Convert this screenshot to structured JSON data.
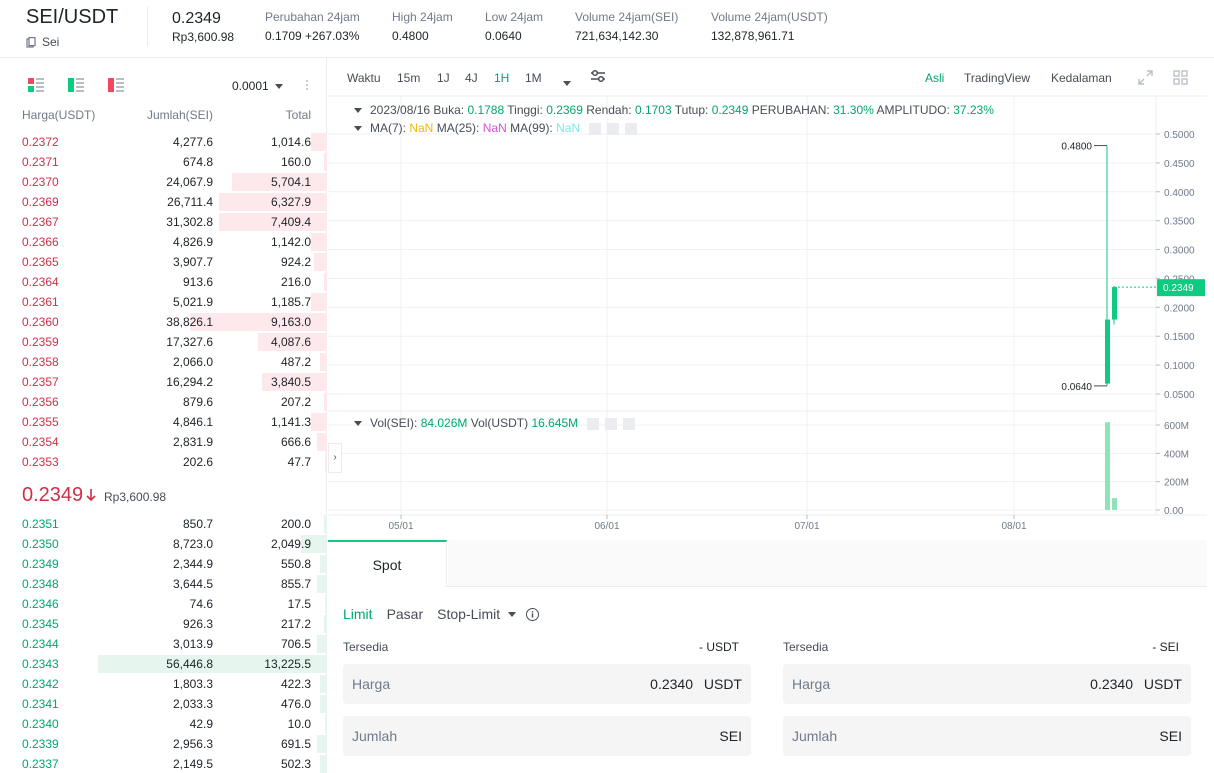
{
  "header": {
    "pair": "SEI/USDT",
    "coin": "Sei",
    "last_price": "0.2349",
    "last_price_local": "Rp3,600.98",
    "stats": [
      {
        "label": "Perubahan 24jam",
        "value": "0.1709 +267.03%",
        "color": "#0ecb81"
      },
      {
        "label": "High 24jam",
        "value": "0.4800"
      },
      {
        "label": "Low 24jam",
        "value": "0.0640"
      },
      {
        "label": "Volume 24jam(SEI)",
        "value": "721,634,142.30"
      },
      {
        "label": "Volume 24jam(USDT)",
        "value": "132,878,961.71"
      }
    ]
  },
  "orderbook": {
    "precision": "0.0001",
    "headers": {
      "price": "Harga(USDT)",
      "amount": "Jumlah(SEI)",
      "total": "Total"
    },
    "asks": [
      {
        "price": "0.2372",
        "amount": "4,277.6",
        "total": "1,014.6",
        "depth": 0.05
      },
      {
        "price": "0.2371",
        "amount": "674.8",
        "total": "160.0",
        "depth": 0.01
      },
      {
        "price": "0.2370",
        "amount": "24,067.9",
        "total": "5,704.1",
        "depth": 0.29
      },
      {
        "price": "0.2369",
        "amount": "26,711.4",
        "total": "6,327.9",
        "depth": 0.33
      },
      {
        "price": "0.2367",
        "amount": "31,302.8",
        "total": "7,409.4",
        "depth": 0.33
      },
      {
        "price": "0.2366",
        "amount": "4,826.9",
        "total": "1,142.0",
        "depth": 0.05
      },
      {
        "price": "0.2365",
        "amount": "3,907.7",
        "total": "924.2",
        "depth": 0.04
      },
      {
        "price": "0.2364",
        "amount": "913.6",
        "total": "216.0",
        "depth": 0.01
      },
      {
        "price": "0.2361",
        "amount": "5,021.9",
        "total": "1,185.7",
        "depth": 0.05
      },
      {
        "price": "0.2360",
        "amount": "38,826.1",
        "total": "9,163.0",
        "depth": 0.42
      },
      {
        "price": "0.2359",
        "amount": "17,327.6",
        "total": "4,087.6",
        "depth": 0.21
      },
      {
        "price": "0.2358",
        "amount": "2,066.0",
        "total": "487.2",
        "depth": 0.02
      },
      {
        "price": "0.2357",
        "amount": "16,294.2",
        "total": "3,840.5",
        "depth": 0.2
      },
      {
        "price": "0.2356",
        "amount": "879.6",
        "total": "207.2",
        "depth": 0.01
      },
      {
        "price": "0.2355",
        "amount": "4,846.1",
        "total": "1,141.3",
        "depth": 0.05
      },
      {
        "price": "0.2354",
        "amount": "2,831.9",
        "total": "666.6",
        "depth": 0.03
      },
      {
        "price": "0.2353",
        "amount": "202.6",
        "total": "47.7",
        "depth": 0.005
      }
    ],
    "mid_price": "0.2349",
    "mid_local": "Rp3,600.98",
    "bids": [
      {
        "price": "0.2351",
        "amount": "850.7",
        "total": "200.0",
        "depth": 0.01
      },
      {
        "price": "0.2350",
        "amount": "8,723.0",
        "total": "2,049.9",
        "depth": 0.08
      },
      {
        "price": "0.2349",
        "amount": "2,344.9",
        "total": "550.8",
        "depth": 0.02
      },
      {
        "price": "0.2348",
        "amount": "3,644.5",
        "total": "855.7",
        "depth": 0.03
      },
      {
        "price": "0.2346",
        "amount": "74.6",
        "total": "17.5",
        "depth": 0.005
      },
      {
        "price": "0.2345",
        "amount": "926.3",
        "total": "217.2",
        "depth": 0.01
      },
      {
        "price": "0.2344",
        "amount": "3,013.9",
        "total": "706.5",
        "depth": 0.03
      },
      {
        "price": "0.2343",
        "amount": "56,446.8",
        "total": "13,225.5",
        "depth": 0.7
      },
      {
        "price": "0.2342",
        "amount": "1,803.3",
        "total": "422.3",
        "depth": 0.02
      },
      {
        "price": "0.2341",
        "amount": "2,033.3",
        "total": "476.0",
        "depth": 0.02
      },
      {
        "price": "0.2340",
        "amount": "42.9",
        "total": "10.0",
        "depth": 0.005
      },
      {
        "price": "0.2339",
        "amount": "2,956.3",
        "total": "691.5",
        "depth": 0.03
      },
      {
        "price": "0.2337",
        "amount": "2,149.5",
        "total": "502.3",
        "depth": 0.02
      }
    ]
  },
  "chart_toolbar": {
    "label": "Waktu",
    "intervals": [
      "15m",
      "1J",
      "4J",
      "1H",
      "1M"
    ],
    "active_interval": "1H",
    "views": [
      "Asli",
      "TradingView",
      "Kedalaman"
    ],
    "active_view": "Asli"
  },
  "chart_legend": {
    "date": "2023/08/16",
    "open_label": "Buka:",
    "open": "0.1788",
    "high_label": "Tinggi:",
    "high": "0.2369",
    "low_label": "Rendah:",
    "low": "0.1703",
    "close_label": "Tutup:",
    "close": "0.2349",
    "change_label": "PERUBAHAN:",
    "change": "31.30%",
    "amp_label": "AMPLITUDO:",
    "amp": "37.23%",
    "ma7_label": "MA(7):",
    "ma7": "NaN",
    "ma25_label": "MA(25):",
    "ma25": "NaN",
    "ma99_label": "MA(99):",
    "ma99": "NaN",
    "vol_sei_label": "Vol(SEI):",
    "vol_sei": "84.026M",
    "vol_usdt_label": "Vol(USDT)",
    "vol_usdt": "16.645M"
  },
  "chart_data": {
    "type": "candlestick",
    "price_axis": {
      "min": 0.05,
      "max": 0.5,
      "ticks": [
        "0.5000",
        "0.4500",
        "0.4000",
        "0.3500",
        "0.3000",
        "0.2500",
        "0.2000",
        "0.1500",
        "0.1000",
        "0.0500"
      ]
    },
    "volume_axis": {
      "max": 600,
      "unit": "M",
      "ticks": [
        "600M",
        "400M",
        "200M",
        "0.00"
      ]
    },
    "x_ticks": [
      "05/01",
      "06/01",
      "07/01",
      "08/01"
    ],
    "current_price": "0.2349",
    "high_annotation": "0.4800",
    "low_annotation": "0.0640",
    "candles": [
      {
        "open": 0.068,
        "high": 0.48,
        "low": 0.064,
        "close": 0.1788,
        "volume": 620
      },
      {
        "open": 0.1788,
        "high": 0.2369,
        "low": 0.1703,
        "close": 0.2349,
        "volume": 84
      }
    ],
    "colors": {
      "up": "#0ecb81",
      "down": "#f6465d",
      "grid": "#f0f1f2"
    }
  },
  "trade": {
    "tab": "Spot",
    "order_types": [
      "Limit",
      "Pasar",
      "Stop-Limit"
    ],
    "active_order_type": "Limit",
    "buy": {
      "available_label": "Tersedia",
      "available": "- USDT",
      "price_label": "Harga",
      "price": "0.2340",
      "price_unit": "USDT",
      "amount_label": "Jumlah",
      "amount_unit": "SEI"
    },
    "sell": {
      "available_label": "Tersedia",
      "available": "- SEI",
      "price_label": "Harga",
      "price": "0.2340",
      "price_unit": "USDT",
      "amount_label": "Jumlah",
      "amount_unit": "SEI"
    }
  }
}
